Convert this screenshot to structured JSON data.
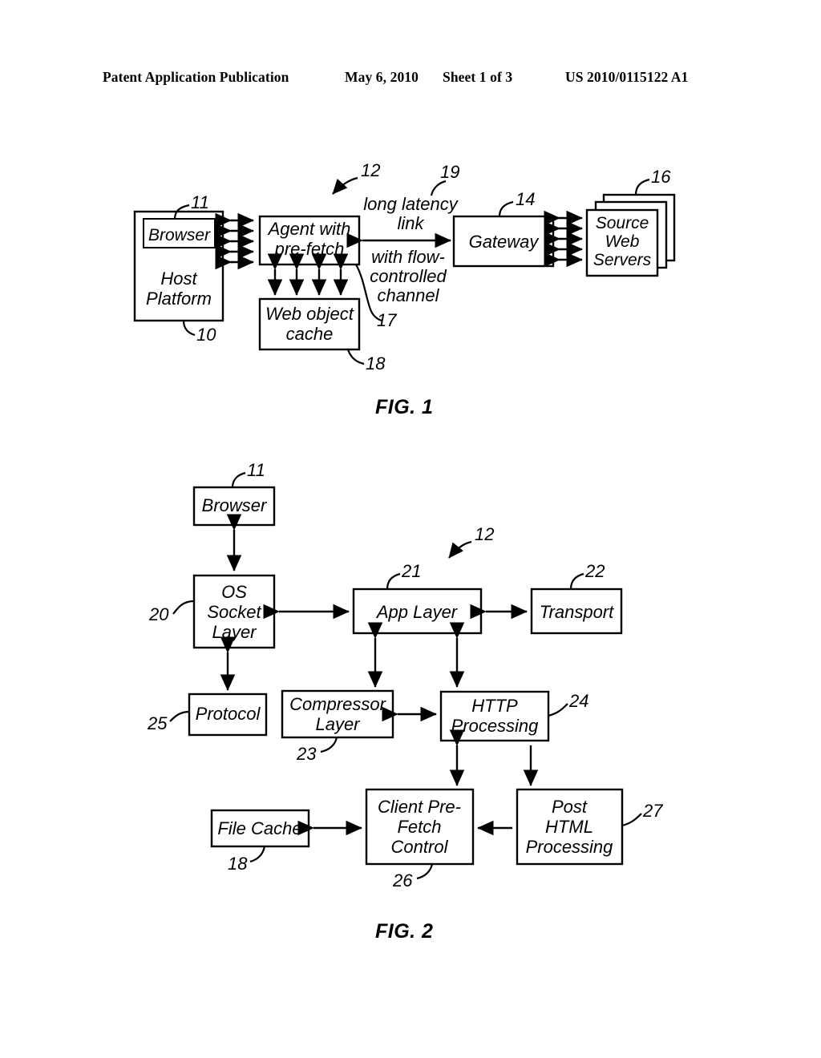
{
  "header": {
    "publication": "Patent Application Publication",
    "date": "May 6, 2010",
    "sheet": "Sheet 1 of 3",
    "patent_number": "US 2010/0115122 A1"
  },
  "figures": [
    {
      "id": "fig1",
      "caption": "FIG. 1",
      "boxes": [
        {
          "key": "host_platform",
          "label": "Host\nPlatform",
          "ref": "10"
        },
        {
          "key": "browser",
          "label": "Browser",
          "ref": "11"
        },
        {
          "key": "agent",
          "label": "Agent with\npre-fetch",
          "ref": "12"
        },
        {
          "key": "web_object_cache",
          "label": "Web object\ncache",
          "ref": "18"
        },
        {
          "key": "gateway",
          "label": "Gateway",
          "ref": "14"
        },
        {
          "key": "source_servers",
          "label": "Source\nWeb\nServers",
          "ref": "16"
        }
      ],
      "annotations": [
        {
          "key": "link_top",
          "text": "long latency\nlink",
          "ref": "19"
        },
        {
          "key": "link_bottom",
          "text": "with flow-\ncontrolled\nchannel",
          "ref": "17"
        }
      ]
    },
    {
      "id": "fig2",
      "caption": "FIG. 2",
      "ref_overall": "12",
      "boxes": [
        {
          "key": "browser",
          "label": "Browser",
          "ref": "11"
        },
        {
          "key": "os_socket",
          "label": "OS\nSocket\nLayer",
          "ref": "20"
        },
        {
          "key": "protocol",
          "label": "Protocol",
          "ref": "25"
        },
        {
          "key": "app_layer",
          "label": "App Layer",
          "ref": "21"
        },
        {
          "key": "transport",
          "label": "Transport",
          "ref": "22"
        },
        {
          "key": "compressor",
          "label": "Compressor\nLayer",
          "ref": "23"
        },
        {
          "key": "http_proc",
          "label": "HTTP\nProcessing",
          "ref": "24"
        },
        {
          "key": "file_cache",
          "label": "File Cache",
          "ref": "18"
        },
        {
          "key": "prefetch_ctl",
          "label": "Client Pre-\nFetch\nControl",
          "ref": "26"
        },
        {
          "key": "post_html",
          "label": "Post\nHTML\nProcessing",
          "ref": "27"
        }
      ]
    }
  ],
  "fig1_text": {
    "host_platform_l1": "Host",
    "host_platform_l2": "Platform",
    "browser": "Browser",
    "agent_l1": "Agent with",
    "agent_l2": "pre-fetch",
    "cache_l1": "Web object",
    "cache_l2": "cache",
    "gateway": "Gateway",
    "servers_l1": "Source",
    "servers_l2": "Web",
    "servers_l3": "Servers",
    "link_l1": "long latency",
    "link_l2": "link",
    "link_l3": "with flow-",
    "link_l4": "controlled",
    "link_l5": "channel",
    "ref_10": "10",
    "ref_11": "11",
    "ref_12": "12",
    "ref_14": "14",
    "ref_16": "16",
    "ref_17": "17",
    "ref_18": "18",
    "ref_19": "19",
    "caption": "FIG. 1"
  },
  "fig2_text": {
    "browser": "Browser",
    "os_l1": "OS",
    "os_l2": "Socket",
    "os_l3": "Layer",
    "protocol": "Protocol",
    "app_layer": "App Layer",
    "transport": "Transport",
    "compressor_l1": "Compressor",
    "compressor_l2": "Layer",
    "http_l1": "HTTP",
    "http_l2": "Processing",
    "file_cache": "File Cache",
    "prefetch_l1": "Client Pre-",
    "prefetch_l2": "Fetch",
    "prefetch_l3": "Control",
    "post_l1": "Post",
    "post_l2": "HTML",
    "post_l3": "Processing",
    "ref_11": "11",
    "ref_12": "12",
    "ref_18": "18",
    "ref_20": "20",
    "ref_21": "21",
    "ref_22": "22",
    "ref_23": "23",
    "ref_24": "24",
    "ref_25": "25",
    "ref_26": "26",
    "ref_27": "27",
    "caption": "FIG. 2"
  }
}
